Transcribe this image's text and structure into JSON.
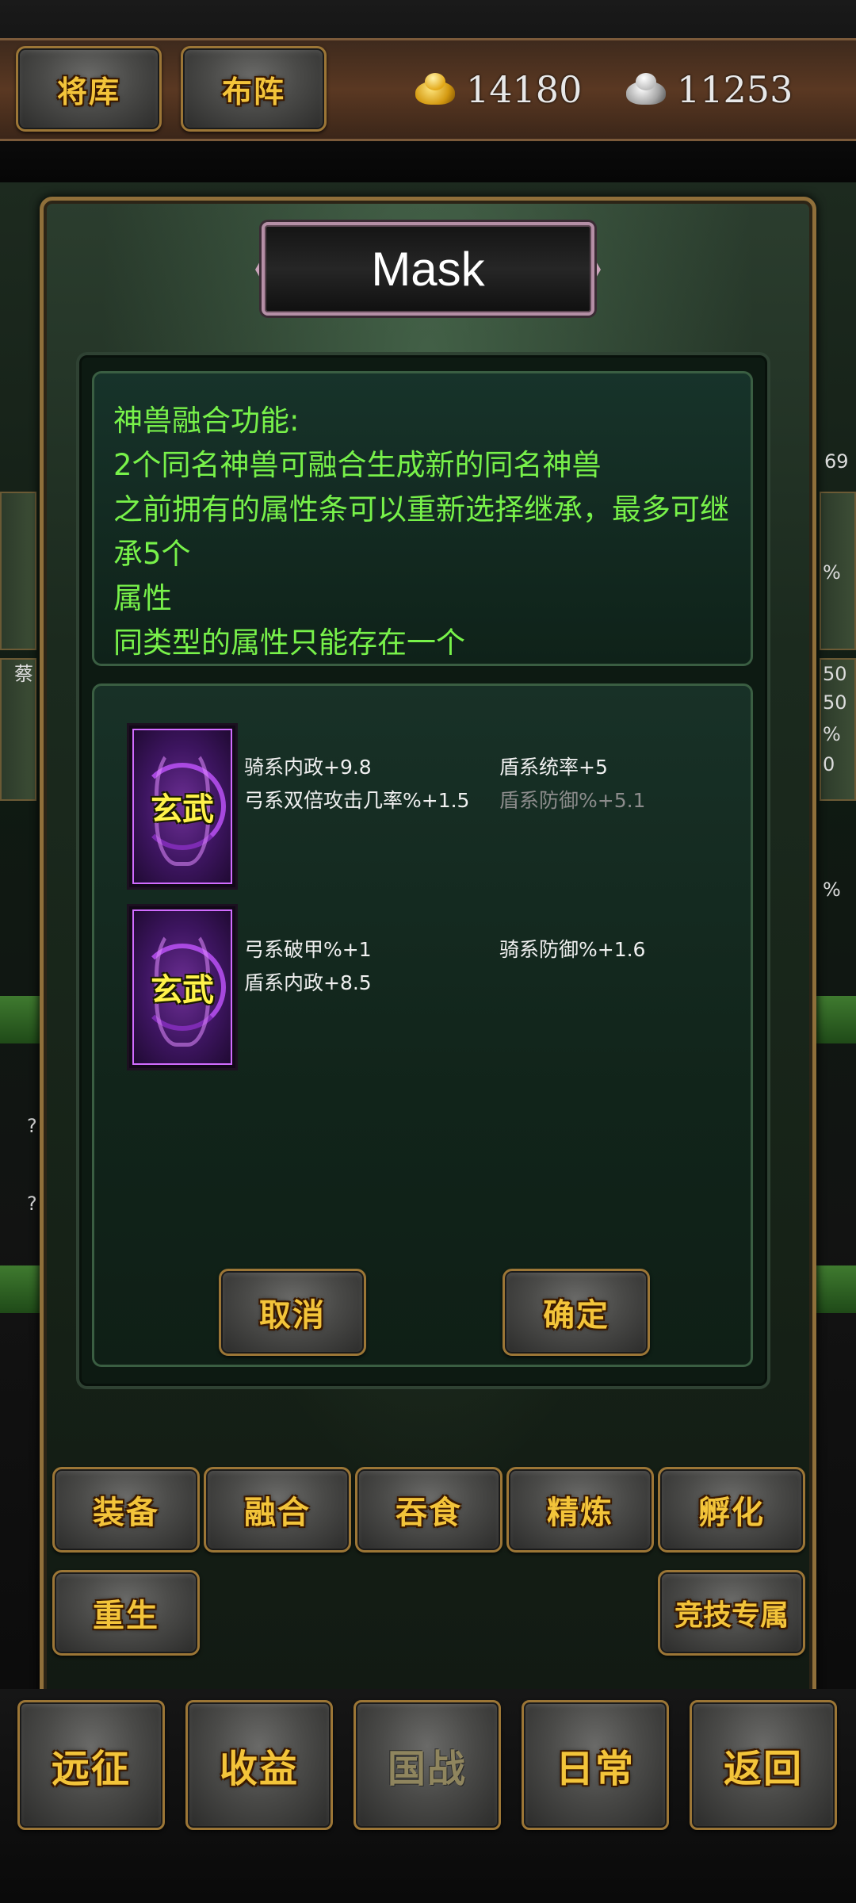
{
  "top": {
    "tabs": [
      "将库",
      "布阵"
    ],
    "gold": "14180",
    "silver": "11253"
  },
  "background": {
    "fragments": [
      "69",
      "蔡",
      "50",
      "50",
      "%",
      "0",
      "%",
      "%",
      "?",
      "?"
    ]
  },
  "dialog": {
    "title": "Mask",
    "description": [
      "神兽融合功能:",
      "2个同名神兽可融合生成新的同名神兽",
      "之前拥有的属性条可以重新选择继承，最多可继承5个",
      "属性",
      "同类型的属性只能存在一个"
    ],
    "beasts": [
      {
        "name": "玄武",
        "attributes": [
          {
            "text": "骑系内政+9.8",
            "dim": false
          },
          {
            "text": "盾系统率+5",
            "dim": false
          },
          {
            "text": "弓系双倍攻击几率%+1.5",
            "dim": false
          },
          {
            "text": "盾系防御%+5.1",
            "dim": true
          }
        ]
      },
      {
        "name": "玄武",
        "attributes": [
          {
            "text": "弓系破甲%+1",
            "dim": false
          },
          {
            "text": "骑系防御%+1.6",
            "dim": false
          },
          {
            "text": "盾系内政+8.5",
            "dim": false
          }
        ]
      }
    ],
    "cancel_label": "取消",
    "confirm_label": "确定"
  },
  "functions": {
    "row1": [
      "装备",
      "融合",
      "吞食",
      "精炼",
      "孵化"
    ],
    "rebirth": "重生",
    "arena": "竞技专属"
  },
  "nav": [
    "远征",
    "收益",
    "国战",
    "日常",
    "返回"
  ],
  "colors": {
    "gold_text": "#f3c43a",
    "desc_green": "#78f24a",
    "attr_white": "#f0f0f0",
    "attr_dim": "#8c8c8c",
    "beast_border": "#d16cff",
    "frame_gold": "#9c7636"
  }
}
